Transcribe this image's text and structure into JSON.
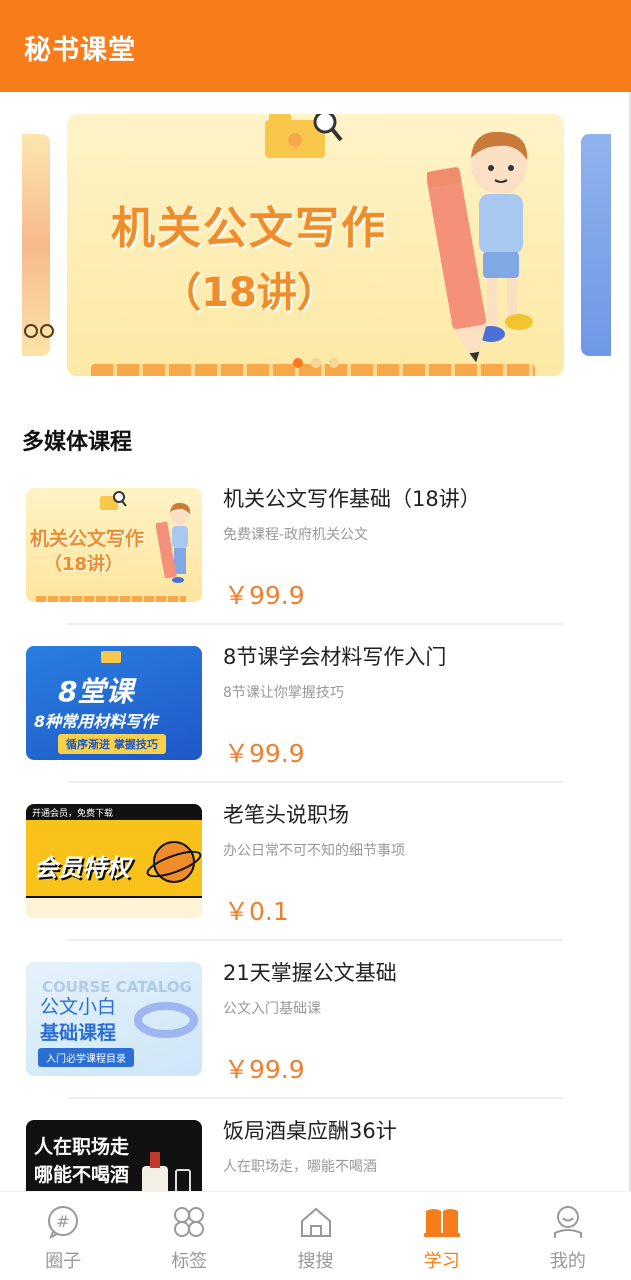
{
  "header": {
    "title": "秘书课堂"
  },
  "banner": {
    "title": "机关公文写作",
    "subtitle": "（18讲）",
    "slide_count": 3,
    "active_index": 0
  },
  "section": {
    "title": "多媒体课程"
  },
  "courses": [
    {
      "name": "机关公文写作基础（18讲）",
      "desc": "免费课程-政府机关公文",
      "price": "￥99.9",
      "thumb": {
        "line1": "机关公文写作",
        "line2": "（18讲）"
      }
    },
    {
      "name": "8节课学会材料写作入门",
      "desc": "8节课让你掌握技巧",
      "price": "￥99.9",
      "thumb": {
        "line1": "8堂课",
        "line2": "8种常用材料写作",
        "line3": "循序渐进 掌握技巧"
      }
    },
    {
      "name": "老笔头说职场",
      "desc": "办公日常不可不知的细节事项",
      "price": "￥0.1",
      "thumb": {
        "line1": "开通会员，免费下载",
        "line2": "会员特权"
      }
    },
    {
      "name": "21天掌握公文基础",
      "desc": "公文入门基础课",
      "price": "￥99.9",
      "thumb": {
        "line0": "COURSE CATALOG",
        "line1": "公文小白",
        "line2": "基础课程",
        "line3": "入门必学课程目录"
      }
    },
    {
      "name": "饭局酒桌应酬36计",
      "desc": "人在职场走，哪能不喝酒",
      "price": "",
      "thumb": {
        "line1": "人在职场走",
        "line2": "哪能不喝酒"
      }
    }
  ],
  "tabs": [
    {
      "label": "圈子",
      "icon": "hashtag-chat-icon"
    },
    {
      "label": "标签",
      "icon": "grid-tags-icon"
    },
    {
      "label": "搜搜",
      "icon": "home-icon"
    },
    {
      "label": "学习",
      "icon": "open-book-icon",
      "active": true
    },
    {
      "label": "我的",
      "icon": "user-icon"
    }
  ],
  "colors": {
    "brand": "#f97c1a",
    "price": "#f08030"
  }
}
